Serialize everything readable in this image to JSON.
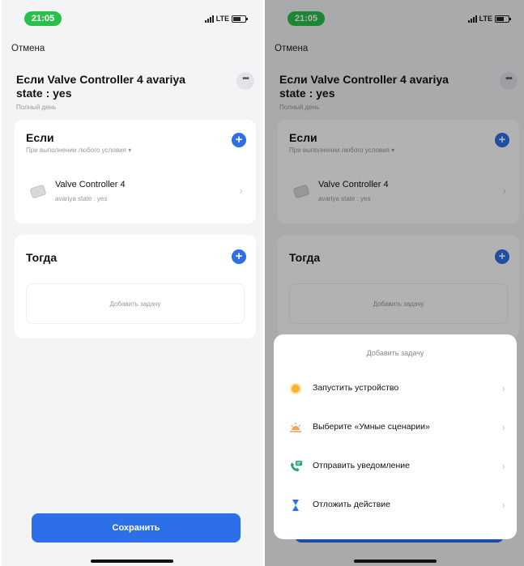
{
  "status": {
    "time": "21:05",
    "network": "LTE"
  },
  "nav": {
    "cancel_label": "Отмена"
  },
  "scene": {
    "title": "Если Valve Controller 4 avariya state : yes",
    "subtitle": "Полный день",
    "more_label": "•••"
  },
  "if_card": {
    "heading": "Если",
    "condition_mode": "При выполнении любого условия",
    "condition_mode_caret": "▾",
    "add_label": "+",
    "device": {
      "name": "Valve Controller 4",
      "state": "avariya state : yes"
    }
  },
  "then_card": {
    "heading": "Тогда",
    "add_label": "+",
    "add_task_label": "Добавить задачу"
  },
  "save_label": "Сохранить",
  "chevron": "›",
  "sheet": {
    "title": "Добавить задачу",
    "items": [
      {
        "label": "Запустить устройство",
        "icon": "sun-icon"
      },
      {
        "label": "Выберите «Умные сценарии»",
        "icon": "sunrise-icon"
      },
      {
        "label": "Отправить уведомление",
        "icon": "notification-phone-icon"
      },
      {
        "label": "Отложить действие",
        "icon": "hourglass-icon"
      }
    ]
  },
  "colors": {
    "accent": "#2c6fe8",
    "time_pill": "#29c14a",
    "background": "#f3f4f6"
  }
}
